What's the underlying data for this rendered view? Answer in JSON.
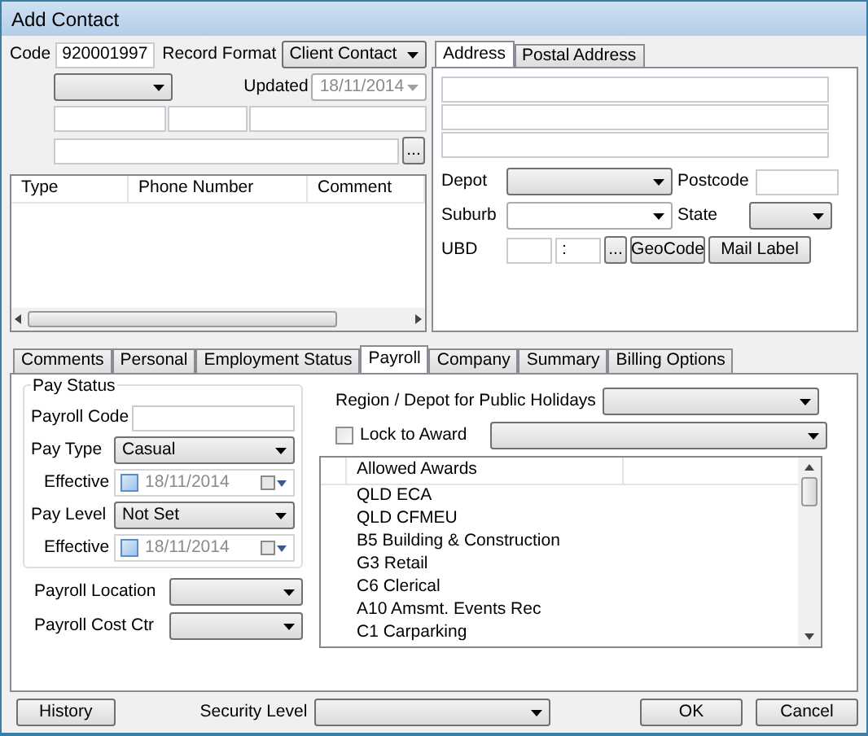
{
  "window": {
    "title": "Add Contact"
  },
  "header": {
    "code_label": "Code",
    "code": "920001997",
    "record_format_label": "Record Format",
    "record_format": "Client Contact",
    "updated_label": "Updated",
    "updated": "18/11/2014",
    "browse_button": "..."
  },
  "phones": {
    "columns": [
      "Type",
      "Phone Number",
      "Comment"
    ]
  },
  "address_tabs": [
    {
      "label": "Address",
      "selected": true
    },
    {
      "label": "Postal Address",
      "selected": false
    }
  ],
  "address": {
    "depot_label": "Depot",
    "postcode_label": "Postcode",
    "suburb_label": "Suburb",
    "state_label": "State",
    "ubd_label": "UBD",
    "ubd_value": ":",
    "ubd_button": "...",
    "geocode_button": "GeoCode",
    "mail_label_button": "Mail Label"
  },
  "tabs": [
    {
      "label": "Comments",
      "selected": false
    },
    {
      "label": "Personal",
      "selected": false
    },
    {
      "label": "Employment Status",
      "selected": false
    },
    {
      "label": "Payroll",
      "selected": true
    },
    {
      "label": "Company",
      "selected": false
    },
    {
      "label": "Summary",
      "selected": false
    },
    {
      "label": "Billing Options",
      "selected": false
    }
  ],
  "pay_status": {
    "title": "Pay Status",
    "payroll_code_label": "Payroll Code",
    "pay_type_label": "Pay Type",
    "pay_type": "Casual",
    "pay_type_effective_label": "Effective",
    "pay_type_effective": {
      "value": "18/11/2014",
      "checked": false
    },
    "pay_level_label": "Pay Level",
    "pay_level": "Not Set",
    "pay_level_effective_label": "Effective",
    "pay_level_effective": {
      "value": "18/11/2014",
      "checked": false
    }
  },
  "payroll_location_label": "Payroll Location",
  "payroll_cost_ctr_label": "Payroll Cost Ctr",
  "region_label": "Region / Depot for Public Holidays",
  "lock_to_award": {
    "label": "Lock to Award",
    "checked": false
  },
  "awards": {
    "header": "Allowed Awards",
    "items": [
      "QLD ECA",
      "QLD CFMEU",
      "B5 Building & Construction",
      "G3 Retail",
      "C6 Clerical",
      "A10 Amsmt. Events Rec",
      "C1 Carparking"
    ]
  },
  "footer": {
    "history_button": "History",
    "security_level_label": "Security Level",
    "ok_button": "OK",
    "cancel_button": "Cancel"
  }
}
